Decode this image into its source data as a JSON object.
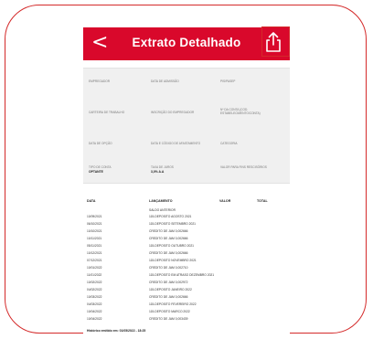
{
  "header": {
    "back_glyph": "<",
    "title": "Extrato Detalhado",
    "share_icon": "share-icon",
    "accent_color": "#d9082b",
    "highlight_color": "#d42a2a"
  },
  "info": {
    "row1": [
      "EMPREGADOR",
      "DATA DE ADMISSÃO",
      "PIS/PASEP"
    ],
    "row2": [
      "CARTEIRA DE TRABALHO",
      "INSCRIÇÃO DO EMPREGADOR",
      "Nº DA CONTA (COD. ESTABELECIMENTO/CONTA)"
    ],
    "row3": [
      "DATA DE OPÇÃO",
      "DATA E CÓDIGO DE AFASTAMENTO",
      "CATEGORIA"
    ],
    "row4_labels": [
      "TIPO DE CONTA",
      "TAXA DE JUROS",
      "VALOR PARA FINS RESCISÓRIOS"
    ],
    "row4_values": [
      "OPTANTE",
      "3,0% a.a",
      ""
    ]
  },
  "table": {
    "headers": [
      "DATA",
      "LANÇAMENTO",
      "VALOR",
      "TOTAL"
    ],
    "saldo": "SALDO ANTERIOR",
    "rows": [
      {
        "date": "10/09/2021",
        "text": "115-DEPOSITO AGOSTO 2021"
      },
      {
        "date": "06/10/2021",
        "text": "115-DEPOSITO SETEMBRO 2021"
      },
      {
        "date": "10/10/2021",
        "text": "CREDITO DE JAM 0,002666"
      },
      {
        "date": "10/11/2021",
        "text": "CREDITO DE JAM 0,002666"
      },
      {
        "date": "05/11/2021",
        "text": "115-DEPOSITO OUTUBRO 2021"
      },
      {
        "date": "10/12/2021",
        "text": "CREDITO DE JAM 0,002666"
      },
      {
        "date": "07/12/2021",
        "text": "115-DEPOSITO NOVEMBRO 2021"
      },
      {
        "date": "10/01/2022",
        "text": "CREDITO DE JAM 0,002710"
      },
      {
        "date": "11/01/2022",
        "text": "115-DEPOSITO EM ATRASO DEZEMBRO 2021"
      },
      {
        "date": "10/02/2022",
        "text": "CREDITO DE JAM 0,002972"
      },
      {
        "date": "04/02/2022",
        "text": "115-DEPOSITO JANEIRO 2022"
      },
      {
        "date": "10/03/2022",
        "text": "CREDITO DE JAM 0,002666"
      },
      {
        "date": "04/03/2022",
        "text": "115-DEPOSITO FEVEREIRO 2022"
      },
      {
        "date": "10/04/2022",
        "text": "115-DEPOSITO MARCO 2022"
      },
      {
        "date": "10/04/2022",
        "text": "CREDITO DE JAM 0,003439"
      }
    ]
  },
  "footer": {
    "text": "Histórico emitido em: 01/05/2022 - 18:25"
  }
}
